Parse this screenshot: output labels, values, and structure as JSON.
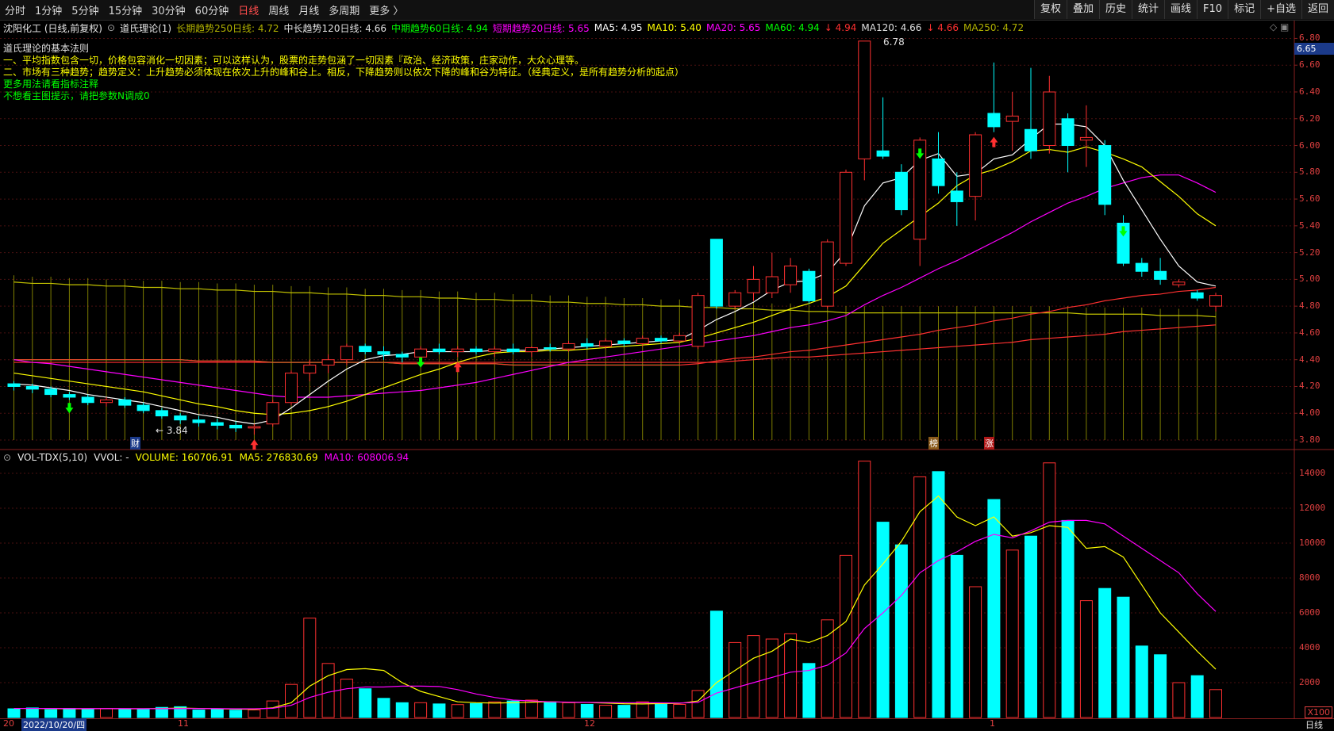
{
  "toolbar": {
    "tabs": [
      "分时",
      "1分钟",
      "5分钟",
      "15分钟",
      "30分钟",
      "60分钟",
      "日线",
      "周线",
      "月线",
      "多周期",
      "更多 〉"
    ],
    "active": "日线",
    "right_buttons": [
      "复权",
      "叠加",
      "历史",
      "统计",
      "画线",
      "F10",
      "标记",
      "+自选",
      "返回"
    ]
  },
  "info": {
    "stock": "沈阳化工 (日线,前复权)",
    "indicator": "道氏理论(1)",
    "long": "长期趋势250日线: 4.72",
    "midlong": "中长趋势120日线: 4.66",
    "mid": "中期趋势60日线: 4.94",
    "short": "短期趋势20日线: 5.65",
    "ma5": "MA5: 4.95",
    "ma10": "MA10: 5.40",
    "ma20": "MA20: 5.65",
    "ma60a": "MA60: 4.94",
    "ma60b": "↓ 4.94",
    "ma120a": "MA120: 4.66",
    "ma120b": "↓ 4.66",
    "ma250": "MA250: 4.72"
  },
  "notes": {
    "title": "道氏理论的基本法则",
    "line1": "一、平均指数包含一切，价格包容消化一切因素；可以这样认为，股票的走势包涵了一切因素『政治、经济政策，庄家动作，大众心理等。",
    "line2": "二、市场有三种趋势；趋势定义：上升趋势必须体现在依次上升的峰和谷上。相反，下降趋势则以依次下降的峰和谷为特征。（经典定义，是所有趋势分析的起点）",
    "line3": "更多用法请看指标注释",
    "line4": "不想看主图提示，请把参数N调成0"
  },
  "volume_info": {
    "name": "VOL-TDX(5,10)",
    "vvol": "VVOL: -",
    "volume": "VOLUME: 160706.91",
    "ma5": "MA5: 276830.69",
    "ma10": "MA10: 608006.94"
  },
  "price_axis": [
    "6.80",
    "6.60",
    "6.40",
    "6.20",
    "6.00",
    "5.80",
    "5.60",
    "5.40",
    "5.20",
    "5.00",
    "4.80",
    "4.60",
    "4.40",
    "4.20",
    "4.00",
    "3.80"
  ],
  "current_price": "6.65",
  "volume_axis": [
    "14000",
    "12000",
    "10000",
    "8000",
    "6000",
    "4000",
    "2000"
  ],
  "volume_unit": "X100",
  "markers": {
    "high": "6.78",
    "low": "← 3.84",
    "cai": "财",
    "bang": "榜",
    "zhang": "涨"
  },
  "date_axis": {
    "date": "2022/10/20/四",
    "prefix": "20",
    "nov": "11",
    "dec": "12",
    "jan": "1",
    "period": "日线"
  },
  "colors": {
    "up": "#ff3030",
    "down": "#00ffff",
    "ma5": "#ffffff",
    "ma10": "#ffff00",
    "ma20": "#ff00ff",
    "ma60": "#00ff00",
    "ma120": "#ff3030",
    "ma250": "#c0c000"
  },
  "chart_data": [
    {
      "type": "candlestick",
      "title": "沈阳化工 (日线,前复权)",
      "ylim": [
        3.8,
        6.85
      ],
      "candles": [
        {
          "o": 4.22,
          "h": 4.24,
          "l": 4.17,
          "c": 4.2
        },
        {
          "o": 4.2,
          "h": 4.22,
          "l": 4.15,
          "c": 4.18
        },
        {
          "o": 4.18,
          "h": 4.2,
          "l": 4.12,
          "c": 4.14
        },
        {
          "o": 4.14,
          "h": 4.16,
          "l": 4.1,
          "c": 4.12
        },
        {
          "o": 4.12,
          "h": 4.14,
          "l": 4.06,
          "c": 4.08
        },
        {
          "o": 4.08,
          "h": 4.12,
          "l": 4.05,
          "c": 4.1
        },
        {
          "o": 4.1,
          "h": 4.12,
          "l": 4.04,
          "c": 4.06
        },
        {
          "o": 4.06,
          "h": 4.08,
          "l": 4.0,
          "c": 4.02
        },
        {
          "o": 4.02,
          "h": 4.04,
          "l": 3.96,
          "c": 3.98
        },
        {
          "o": 3.98,
          "h": 4.0,
          "l": 3.92,
          "c": 3.95
        },
        {
          "o": 3.95,
          "h": 3.98,
          "l": 3.9,
          "c": 3.93
        },
        {
          "o": 3.93,
          "h": 3.96,
          "l": 3.88,
          "c": 3.91
        },
        {
          "o": 3.91,
          "h": 3.94,
          "l": 3.86,
          "c": 3.89
        },
        {
          "o": 3.89,
          "h": 3.92,
          "l": 3.84,
          "c": 3.9
        },
        {
          "o": 3.92,
          "h": 4.1,
          "l": 3.9,
          "c": 4.08
        },
        {
          "o": 4.08,
          "h": 4.32,
          "l": 4.06,
          "c": 4.3
        },
        {
          "o": 4.3,
          "h": 4.4,
          "l": 4.24,
          "c": 4.36
        },
        {
          "o": 4.36,
          "h": 4.44,
          "l": 4.3,
          "c": 4.4
        },
        {
          "o": 4.4,
          "h": 4.52,
          "l": 4.36,
          "c": 4.5
        },
        {
          "o": 4.5,
          "h": 4.52,
          "l": 4.44,
          "c": 4.46
        },
        {
          "o": 4.46,
          "h": 4.5,
          "l": 4.4,
          "c": 4.44
        },
        {
          "o": 4.44,
          "h": 4.46,
          "l": 4.38,
          "c": 4.42
        },
        {
          "o": 4.42,
          "h": 4.5,
          "l": 4.4,
          "c": 4.48
        },
        {
          "o": 4.48,
          "h": 4.52,
          "l": 4.44,
          "c": 4.46
        },
        {
          "o": 4.46,
          "h": 4.5,
          "l": 4.42,
          "c": 4.48
        },
        {
          "o": 4.48,
          "h": 4.5,
          "l": 4.44,
          "c": 4.46
        },
        {
          "o": 4.46,
          "h": 4.5,
          "l": 4.42,
          "c": 4.48
        },
        {
          "o": 4.48,
          "h": 4.52,
          "l": 4.44,
          "c": 4.46
        },
        {
          "o": 4.46,
          "h": 4.5,
          "l": 4.42,
          "c": 4.49
        },
        {
          "o": 4.49,
          "h": 4.52,
          "l": 4.46,
          "c": 4.48
        },
        {
          "o": 4.48,
          "h": 4.54,
          "l": 4.46,
          "c": 4.52
        },
        {
          "o": 4.52,
          "h": 4.56,
          "l": 4.48,
          "c": 4.5
        },
        {
          "o": 4.5,
          "h": 4.56,
          "l": 4.48,
          "c": 4.54
        },
        {
          "o": 4.54,
          "h": 4.56,
          "l": 4.5,
          "c": 4.52
        },
        {
          "o": 4.52,
          "h": 4.58,
          "l": 4.5,
          "c": 4.56
        },
        {
          "o": 4.56,
          "h": 4.58,
          "l": 4.52,
          "c": 4.54
        },
        {
          "o": 4.54,
          "h": 4.6,
          "l": 4.52,
          "c": 4.58
        },
        {
          "o": 4.5,
          "h": 4.9,
          "l": 4.48,
          "c": 4.88
        },
        {
          "o": 5.3,
          "h": 5.3,
          "l": 4.78,
          "c": 4.8
        },
        {
          "o": 4.8,
          "h": 4.92,
          "l": 4.78,
          "c": 4.9
        },
        {
          "o": 4.9,
          "h": 5.1,
          "l": 4.84,
          "c": 5.0
        },
        {
          "o": 4.9,
          "h": 5.2,
          "l": 4.86,
          "c": 5.02
        },
        {
          "o": 4.96,
          "h": 5.16,
          "l": 4.9,
          "c": 5.1
        },
        {
          "o": 5.06,
          "h": 5.08,
          "l": 4.82,
          "c": 4.84
        },
        {
          "o": 4.8,
          "h": 5.3,
          "l": 4.78,
          "c": 5.28
        },
        {
          "o": 5.12,
          "h": 5.82,
          "l": 5.1,
          "c": 5.8
        },
        {
          "o": 5.9,
          "h": 6.78,
          "l": 5.74,
          "c": 6.78
        },
        {
          "o": 5.96,
          "h": 6.36,
          "l": 5.9,
          "c": 5.92
        },
        {
          "o": 5.8,
          "h": 5.86,
          "l": 5.48,
          "c": 5.52
        },
        {
          "o": 5.3,
          "h": 6.06,
          "l": 5.1,
          "c": 6.04
        },
        {
          "o": 5.9,
          "h": 6.1,
          "l": 5.64,
          "c": 5.7
        },
        {
          "o": 5.66,
          "h": 5.8,
          "l": 5.4,
          "c": 5.58
        },
        {
          "o": 5.62,
          "h": 6.1,
          "l": 5.44,
          "c": 6.08
        },
        {
          "o": 6.24,
          "h": 6.62,
          "l": 6.1,
          "c": 6.14
        },
        {
          "o": 6.18,
          "h": 6.4,
          "l": 5.96,
          "c": 6.22
        },
        {
          "o": 6.12,
          "h": 6.58,
          "l": 5.9,
          "c": 5.96
        },
        {
          "o": 6.0,
          "h": 6.52,
          "l": 5.94,
          "c": 6.4
        },
        {
          "o": 6.2,
          "h": 6.24,
          "l": 5.8,
          "c": 6.0
        },
        {
          "o": 6.04,
          "h": 6.3,
          "l": 5.84,
          "c": 6.06
        },
        {
          "o": 6.0,
          "h": 6.04,
          "l": 5.48,
          "c": 5.56
        },
        {
          "o": 5.42,
          "h": 5.48,
          "l": 5.1,
          "c": 5.12
        },
        {
          "o": 5.12,
          "h": 5.16,
          "l": 5.02,
          "c": 5.06
        },
        {
          "o": 5.06,
          "h": 5.16,
          "l": 4.96,
          "c": 5.0
        },
        {
          "o": 4.96,
          "h": 5.0,
          "l": 4.94,
          "c": 4.98
        },
        {
          "o": 4.9,
          "h": 4.92,
          "l": 4.84,
          "c": 4.86
        },
        {
          "o": 4.8,
          "h": 4.9,
          "l": 4.76,
          "c": 4.88
        }
      ],
      "ma5": [
        4.22,
        4.21,
        4.19,
        4.17,
        4.14,
        4.12,
        4.1,
        4.08,
        4.05,
        4.02,
        3.99,
        3.97,
        3.94,
        3.92,
        3.95,
        4.04,
        4.14,
        4.24,
        4.33,
        4.4,
        4.43,
        4.44,
        4.46,
        4.46,
        4.46,
        4.46,
        4.47,
        4.47,
        4.47,
        4.48,
        4.49,
        4.5,
        4.51,
        4.52,
        4.53,
        4.54,
        4.55,
        4.62,
        4.7,
        4.76,
        4.83,
        4.92,
        4.98,
        4.99,
        5.05,
        5.21,
        5.55,
        5.72,
        5.76,
        5.89,
        5.94,
        5.77,
        5.79,
        5.9,
        5.93,
        6.05,
        6.16,
        6.16,
        6.14,
        6.0,
        5.74,
        5.52,
        5.3,
        5.1,
        4.98,
        4.95
      ],
      "ma10": [
        4.3,
        4.28,
        4.26,
        4.24,
        4.22,
        4.2,
        4.18,
        4.16,
        4.13,
        4.1,
        4.07,
        4.05,
        4.02,
        4.0,
        3.99,
        4.0,
        4.02,
        4.05,
        4.09,
        4.14,
        4.19,
        4.24,
        4.29,
        4.33,
        4.38,
        4.42,
        4.45,
        4.46,
        4.46,
        4.47,
        4.47,
        4.48,
        4.49,
        4.5,
        4.51,
        4.52,
        4.53,
        4.56,
        4.6,
        4.64,
        4.68,
        4.73,
        4.78,
        4.82,
        4.87,
        4.95,
        5.11,
        5.27,
        5.37,
        5.47,
        5.57,
        5.7,
        5.78,
        5.82,
        5.88,
        5.96,
        5.97,
        5.95,
        5.99,
        5.95,
        5.9,
        5.84,
        5.73,
        5.62,
        5.49,
        5.4
      ],
      "ma20": [
        4.4,
        4.38,
        4.37,
        4.35,
        4.33,
        4.31,
        4.29,
        4.27,
        4.25,
        4.23,
        4.21,
        4.19,
        4.17,
        4.15,
        4.13,
        4.12,
        4.12,
        4.12,
        4.13,
        4.14,
        4.15,
        4.16,
        4.17,
        4.19,
        4.21,
        4.23,
        4.26,
        4.29,
        4.32,
        4.35,
        4.38,
        4.4,
        4.42,
        4.44,
        4.46,
        4.48,
        4.5,
        4.52,
        4.54,
        4.56,
        4.58,
        4.61,
        4.64,
        4.66,
        4.69,
        4.73,
        4.81,
        4.88,
        4.94,
        5.01,
        5.08,
        5.14,
        5.21,
        5.28,
        5.35,
        5.43,
        5.5,
        5.57,
        5.62,
        5.68,
        5.72,
        5.76,
        5.78,
        5.78,
        5.72,
        5.65
      ],
      "ma60": [
        4.4,
        4.4,
        4.4,
        4.4,
        4.4,
        4.4,
        4.4,
        4.4,
        4.4,
        4.4,
        4.39,
        4.39,
        4.39,
        4.39,
        4.38,
        4.38,
        4.38,
        4.38,
        4.38,
        4.38,
        4.38,
        4.37,
        4.37,
        4.37,
        4.37,
        4.37,
        4.37,
        4.36,
        4.36,
        4.36,
        4.36,
        4.36,
        4.36,
        4.36,
        4.36,
        4.36,
        4.36,
        4.37,
        4.39,
        4.41,
        4.42,
        4.44,
        4.46,
        4.47,
        4.49,
        4.51,
        4.53,
        4.55,
        4.57,
        4.59,
        4.62,
        4.64,
        4.66,
        4.69,
        4.71,
        4.74,
        4.76,
        4.79,
        4.81,
        4.84,
        4.86,
        4.88,
        4.89,
        4.91,
        4.92,
        4.94
      ],
      "ma120": [
        4.38,
        4.38,
        4.38,
        4.38,
        4.38,
        4.38,
        4.38,
        4.38,
        4.38,
        4.38,
        4.38,
        4.38,
        4.38,
        4.38,
        4.38,
        4.38,
        4.38,
        4.38,
        4.38,
        4.38,
        4.38,
        4.38,
        4.38,
        4.38,
        4.38,
        4.38,
        4.38,
        4.38,
        4.38,
        4.38,
        4.38,
        4.38,
        4.38,
        4.38,
        4.38,
        4.38,
        4.38,
        4.38,
        4.38,
        4.39,
        4.4,
        4.41,
        4.42,
        4.42,
        4.43,
        4.44,
        4.45,
        4.46,
        4.47,
        4.48,
        4.49,
        4.5,
        4.51,
        4.52,
        4.53,
        4.55,
        4.56,
        4.57,
        4.58,
        4.59,
        4.61,
        4.62,
        4.63,
        4.64,
        4.65,
        4.66
      ],
      "ma250": [
        4.98,
        4.97,
        4.97,
        4.96,
        4.96,
        4.95,
        4.95,
        4.94,
        4.94,
        4.93,
        4.93,
        4.92,
        4.92,
        4.91,
        4.91,
        4.9,
        4.9,
        4.89,
        4.89,
        4.88,
        4.88,
        4.87,
        4.87,
        4.86,
        4.86,
        4.85,
        4.85,
        4.84,
        4.84,
        4.83,
        4.83,
        4.82,
        4.82,
        4.81,
        4.81,
        4.8,
        4.8,
        4.79,
        4.79,
        4.78,
        4.78,
        4.77,
        4.77,
        4.76,
        4.76,
        4.75,
        4.75,
        4.75,
        4.75,
        4.75,
        4.75,
        4.75,
        4.75,
        4.75,
        4.75,
        4.75,
        4.75,
        4.75,
        4.74,
        4.74,
        4.74,
        4.74,
        4.73,
        4.73,
        4.73,
        4.72
      ],
      "buy_signals": [
        13,
        24,
        53
      ],
      "sell_signals": [
        3,
        22,
        49,
        60
      ]
    },
    {
      "type": "bar",
      "title": "VOL-TDX(5,10)",
      "ylim": [
        0,
        15000
      ],
      "volumes": [
        500,
        550,
        450,
        520,
        480,
        510,
        490,
        500,
        580,
        620,
        430,
        480,
        420,
        440,
        950,
        1900,
        5700,
        3100,
        2200,
        1650,
        1100,
        850,
        850,
        780,
        740,
        800,
        900,
        950,
        1000,
        900,
        850,
        750,
        700,
        700,
        900,
        800,
        750,
        1550,
        6100,
        4300,
        4700,
        4500,
        4800,
        3100,
        5600,
        9300,
        14700,
        11200,
        9900,
        13800,
        14100,
        9300,
        7500,
        12500,
        9600,
        10400,
        14600,
        11300,
        6700,
        7400,
        6900,
        4100,
        3600,
        2000,
        2400,
        1600
      ],
      "ma5": [
        520,
        520,
        510,
        500,
        500,
        510,
        500,
        500,
        520,
        540,
        520,
        500,
        480,
        470,
        560,
        850,
        1800,
        2400,
        2750,
        2800,
        2700,
        2000,
        1500,
        1200,
        900,
        850,
        830,
        850,
        880,
        900,
        870,
        860,
        830,
        790,
        780,
        800,
        810,
        950,
        2000,
        2700,
        3400,
        3800,
        4500,
        4300,
        4700,
        5500,
        7600,
        8800,
        10100,
        11800,
        12700,
        11500,
        11000,
        11500,
        10400,
        10600,
        11000,
        10900,
        9700,
        9800,
        9200,
        7600,
        6000,
        4900,
        3800,
        2768
      ],
      "ma10": [
        520,
        520,
        520,
        510,
        510,
        510,
        510,
        505,
        505,
        510,
        510,
        510,
        500,
        500,
        530,
        700,
        1150,
        1450,
        1650,
        1750,
        1750,
        1800,
        1800,
        1780,
        1600,
        1350,
        1150,
        1000,
        950,
        900,
        880,
        870,
        860,
        850,
        850,
        840,
        830,
        870,
        1400,
        1700,
        2000,
        2300,
        2600,
        2700,
        3000,
        3700,
        5100,
        6000,
        7000,
        8300,
        9000,
        9500,
        10100,
        10500,
        10300,
        10700,
        11200,
        11300,
        11300,
        11100,
        10400,
        9700,
        9000,
        8300,
        7100,
        6080
      ],
      "markers": [
        16,
        38,
        46,
        50,
        56
      ]
    }
  ]
}
